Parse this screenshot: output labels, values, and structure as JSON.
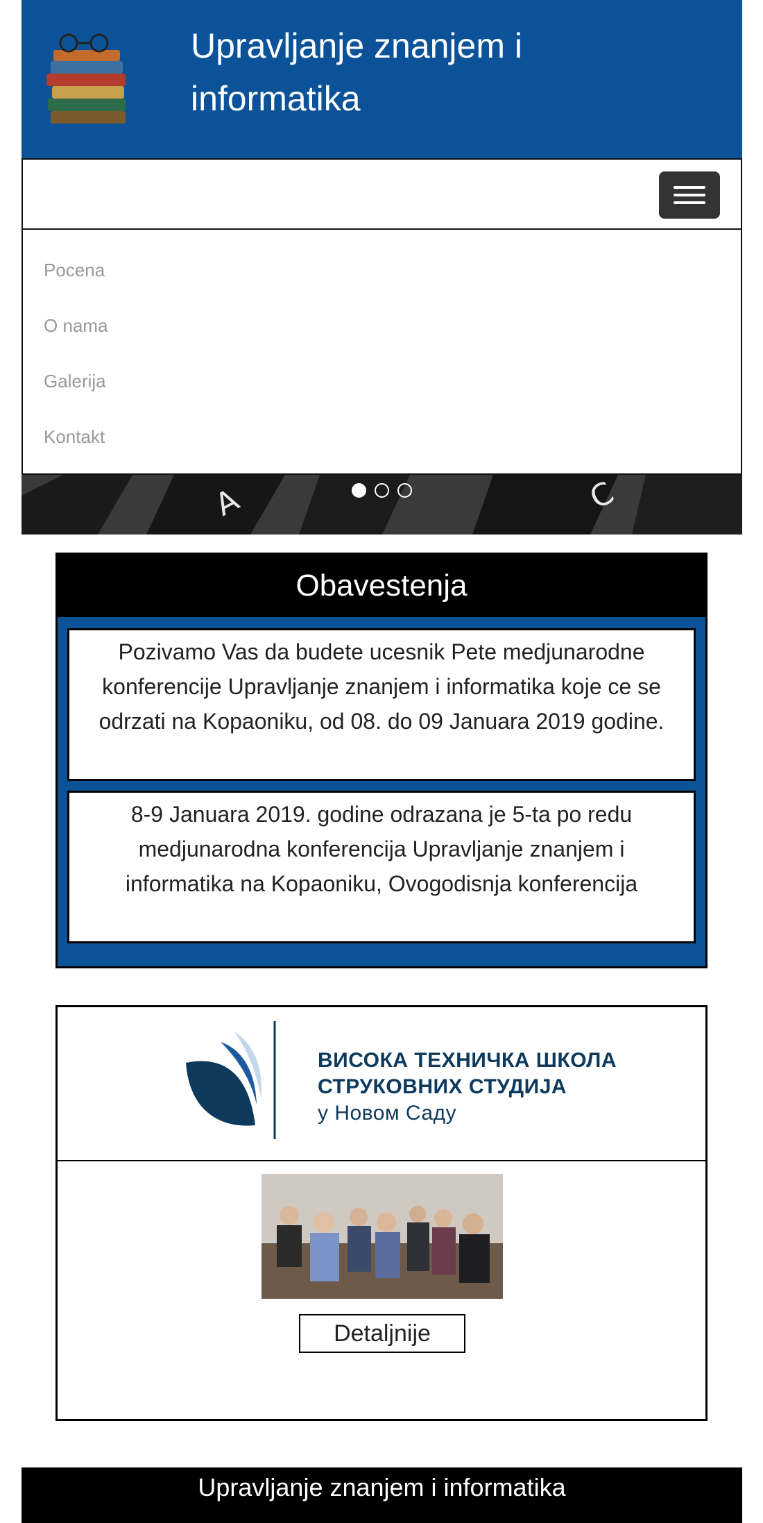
{
  "header": {
    "title": "Upravljanje znanjem i informatika"
  },
  "nav": {
    "items": [
      {
        "label": "Pocena"
      },
      {
        "label": "O nama"
      },
      {
        "label": "Galerija"
      },
      {
        "label": "Kontakt"
      }
    ]
  },
  "carousel": {
    "slide_count": 3,
    "active_index": 0
  },
  "notices": {
    "heading": "Obavestenja",
    "items": [
      {
        "text": "Pozivamo Vas da budete ucesnik Pete medjunarodne konferencije Upravljanje znanjem i informatika koje ce se odrzati na Kopaoniku, od 08. do 09 Januara 2019 godine."
      },
      {
        "text": "8-9 Januara 2019. godine odrazana je 5-ta po redu medjunarodna konferencija Upravljanje znanjem i informatika na Kopaoniku, Ovogodisnja konferencija"
      }
    ]
  },
  "school": {
    "name_line1": "ВИСОКА ТЕХНИЧКА ШКОЛА",
    "name_line2": "СТРУКОВНИХ СТУДИЈА",
    "name_line3": "у Новом Саду",
    "details_button": "Detaljnije"
  },
  "footer": {
    "text": "Upravljanje znanjem i informatika"
  },
  "colors": {
    "brand_blue": "#0b5299",
    "black": "#000000",
    "menu_text": "#999999"
  }
}
